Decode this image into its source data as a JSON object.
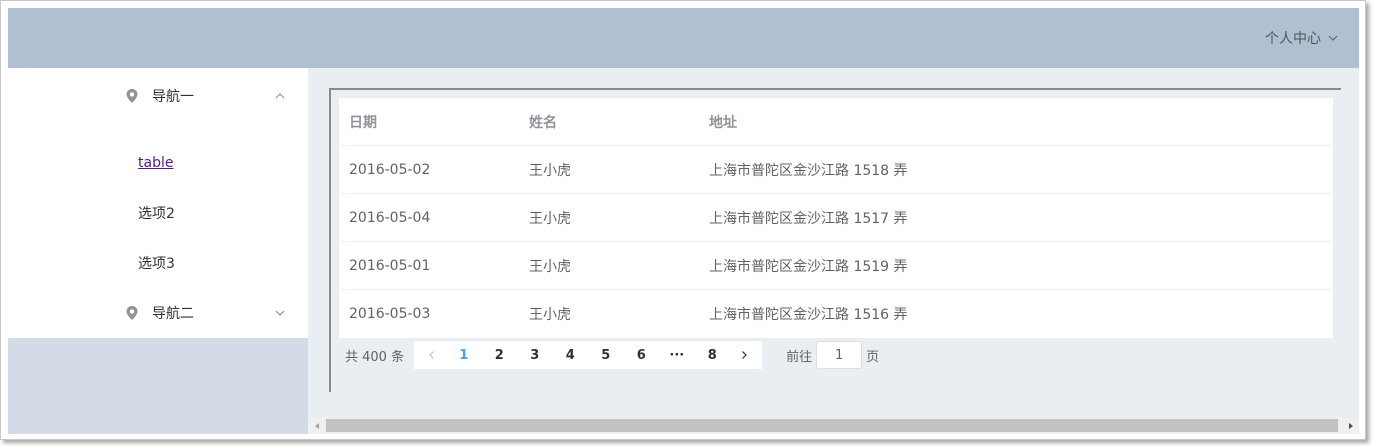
{
  "header": {
    "user_menu_label": "个人中心"
  },
  "sidebar": {
    "nav1": {
      "label": "导航一"
    },
    "items": [
      {
        "label": "table"
      },
      {
        "label": "选项2"
      },
      {
        "label": "选项3"
      }
    ],
    "nav2": {
      "label": "导航二"
    }
  },
  "table": {
    "headers": {
      "date": "日期",
      "name": "姓名",
      "address": "地址"
    },
    "rows": [
      {
        "date": "2016-05-02",
        "name": "王小虎",
        "address": "上海市普陀区金沙江路 1518 弄"
      },
      {
        "date": "2016-05-04",
        "name": "王小虎",
        "address": "上海市普陀区金沙江路 1517 弄"
      },
      {
        "date": "2016-05-01",
        "name": "王小虎",
        "address": "上海市普陀区金沙江路 1519 弄"
      },
      {
        "date": "2016-05-03",
        "name": "王小虎",
        "address": "上海市普陀区金沙江路 1516 弄"
      }
    ]
  },
  "pagination": {
    "total_text": "共 400 条",
    "pages": [
      "1",
      "2",
      "3",
      "4",
      "5",
      "6",
      "···",
      "8"
    ],
    "current": "1",
    "goto_label": "前往",
    "goto_value": "1",
    "page_unit": "页"
  },
  "colors": {
    "header_bg": "#b0c0d3",
    "sidebar_bg": "#d3dce6",
    "main_bg": "#e9eef3",
    "active_page": "#409eff"
  },
  "icons": {
    "user_dropdown": "chevron-down-icon",
    "nav_icon": "location-icon",
    "nav1_arrow": "chevron-up-icon",
    "nav2_arrow": "chevron-down-icon",
    "prev": "chevron-left-icon",
    "next": "chevron-right-icon"
  }
}
